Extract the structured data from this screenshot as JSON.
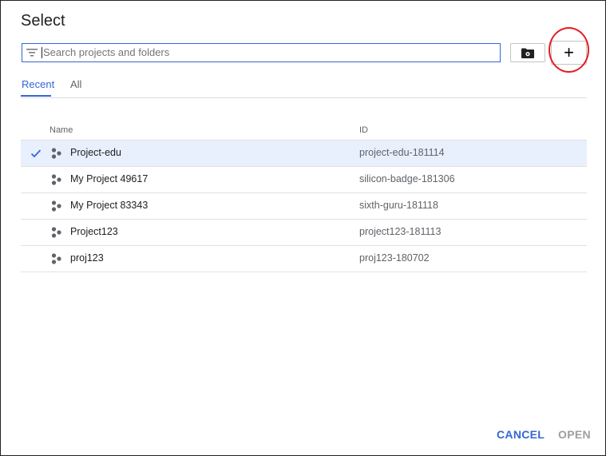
{
  "dialog": {
    "title": "Select",
    "search": {
      "placeholder": "Search projects and folders",
      "value": ""
    },
    "folder_button_icon": "folder-gear-icon",
    "add_button_label": "+",
    "tabs": [
      {
        "label": "Recent",
        "active": true
      },
      {
        "label": "All",
        "active": false
      }
    ],
    "table": {
      "headers": {
        "name": "Name",
        "id": "ID"
      },
      "rows": [
        {
          "name": "Project-edu",
          "id": "project-edu-181114",
          "selected": true
        },
        {
          "name": "My Project 49617",
          "id": "silicon-badge-181306",
          "selected": false
        },
        {
          "name": "My Project 83343",
          "id": "sixth-guru-181118",
          "selected": false
        },
        {
          "name": "Project123",
          "id": "project123-181113",
          "selected": false
        },
        {
          "name": "proj123",
          "id": "proj123-180702",
          "selected": false
        }
      ]
    },
    "footer": {
      "cancel_label": "CANCEL",
      "open_label": "OPEN"
    },
    "colors": {
      "accent": "#3367d6",
      "highlight": "#e8f0fe",
      "annotation": "#e51c23"
    }
  }
}
